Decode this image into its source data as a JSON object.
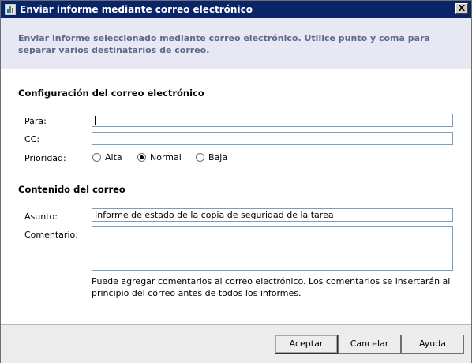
{
  "window": {
    "title": "Enviar informe mediante correo electrónico",
    "close_glyph": "X"
  },
  "header": {
    "instructions": "Enviar informe seleccionado mediante correo electrónico. Utilice punto y coma para separar varios destinatarios de correo."
  },
  "email_config": {
    "section_title": "Configuración del correo electrónico",
    "to_label": "Para:",
    "to_value": "",
    "cc_label": "CC:",
    "cc_value": "",
    "priority_label": "Prioridad:",
    "priority_options": [
      "Alta",
      "Normal",
      "Baja"
    ],
    "priority_selected": "Normal"
  },
  "email_content": {
    "section_title": "Contenido del correo",
    "subject_label": "Asunto:",
    "subject_value": "Informe de estado de la copia de seguridad de la tarea",
    "comment_label": "Comentario:",
    "comment_value": "",
    "comment_hint": "Puede agregar comentarios al correo electrónico. Los comentarios se insertarán al principio del correo antes de todos los informes."
  },
  "footer": {
    "accept_label": "Aceptar",
    "cancel_label": "Cancelar",
    "help_label": "Ayuda"
  }
}
